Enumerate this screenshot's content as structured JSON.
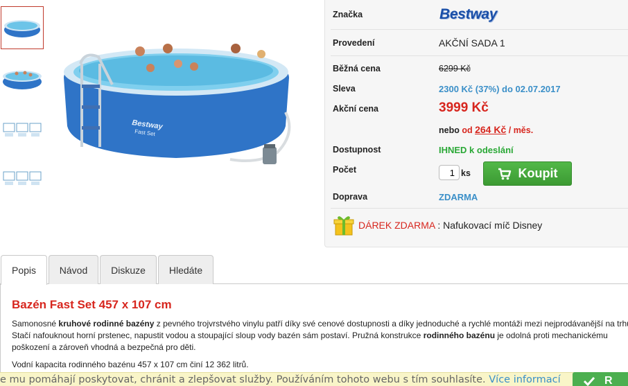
{
  "thumbnails": [
    "pool-thumbnail-1",
    "pool-thumbnail-2",
    "pool-thumbnail-3",
    "pool-thumbnail-4"
  ],
  "product": {
    "brand_label": "Značka",
    "brand_logo_text": "Bestway",
    "variant_label": "Provedení",
    "variant_value": "AKČNÍ SADA 1",
    "regular_price_label": "Běžná cena",
    "regular_price_value": "6299 Kč",
    "discount_label": "Sleva",
    "discount_value": "2300 Kč (37%) do 02.07.2017",
    "action_price_label": "Akční cena",
    "action_price_value": "3999 Kč",
    "installment_prefix": "nebo",
    "installment_od": "od",
    "installment_amount": "264 Kč",
    "installment_suffix": "/ měs.",
    "availability_label": "Dostupnost",
    "availability_value": "IHNED k odeslání",
    "quantity_label": "Počet",
    "quantity_value": "1",
    "quantity_unit": "ks",
    "buy_label": "Koupit",
    "shipping_label": "Doprava",
    "shipping_value": "ZDARMA",
    "gift_title": "DÁREK ZDARMA",
    "gift_separator": " : ",
    "gift_value": "Nafukovací míč Disney"
  },
  "tabs": [
    {
      "label": "Popis"
    },
    {
      "label": "Návod"
    },
    {
      "label": "Diskuze"
    },
    {
      "label": "Hledáte"
    }
  ],
  "description": {
    "title": "Bazén Fast Set 457 x 107 cm",
    "p1_part1": "Samonosné ",
    "p1_bold1": "kruhové rodinné bazény",
    "p1_part2": " z pevného trojvrstvého vinylu patří díky své cenové dostupnosti a díky jednoduché a rychlé montáži mezi nejprodávanější na trhu.",
    "p1_line2a": "Stačí nafouknout horní prstenec, napustit vodou a stoupající sloup vody bazén sám postaví. Pružná konstrukce ",
    "p1_bold2": "rodinného bazénu",
    "p1_line2b": " je odolná proti mechanickému",
    "p1_line3": "poškození a zároveň vhodná a bezpečná pro děti.",
    "p2": "Vodní kapacita rodinného bazénu 457 x 107 cm činí 12 362 litrů."
  },
  "cookie_bar": {
    "text": "e mu pomáhají poskytovat, chránit a zlepšovat služby. Používáním tohoto webu s tím souhlasíte.",
    "link": "Více informací",
    "button_label": "R"
  },
  "colors": {
    "accent_red": "#d7261e",
    "accent_blue": "#3a8fc8",
    "accent_green": "#2aa836",
    "buy_button": "#46aa3d"
  }
}
